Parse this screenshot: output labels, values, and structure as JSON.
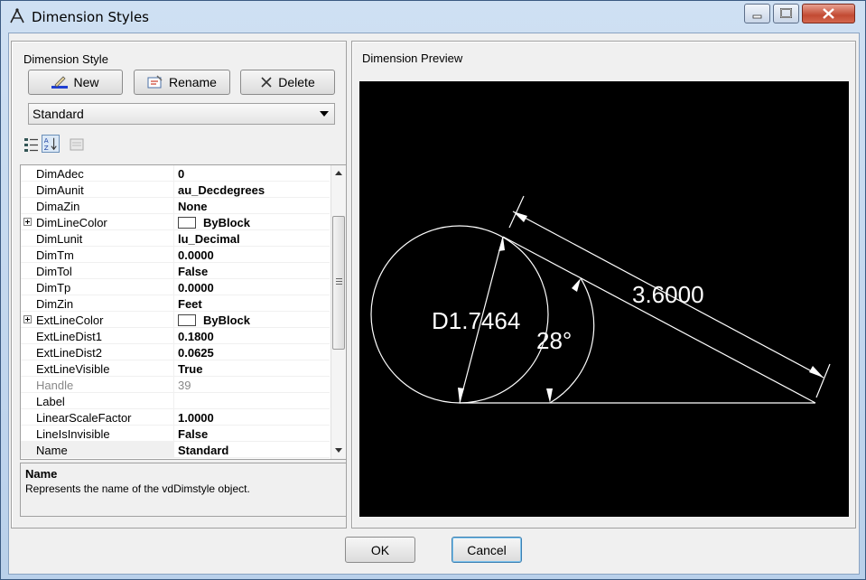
{
  "window": {
    "title": "Dimension Styles"
  },
  "left": {
    "group_label": "Dimension Style",
    "buttons": {
      "new": "New",
      "rename": "Rename",
      "delete": "Delete"
    },
    "style_select": "Standard",
    "properties": [
      {
        "name": "DimAdec",
        "value": "0"
      },
      {
        "name": "DimAunit",
        "value": "au_Decdegrees"
      },
      {
        "name": "DimaZin",
        "value": "None"
      },
      {
        "name": "DimLineColor",
        "value": "ByBlock",
        "expandable": true,
        "swatch": "#ffffff"
      },
      {
        "name": "DimLunit",
        "value": "lu_Decimal"
      },
      {
        "name": "DimTm",
        "value": "0.0000"
      },
      {
        "name": "DimTol",
        "value": "False"
      },
      {
        "name": "DimTp",
        "value": "0.0000"
      },
      {
        "name": "DimZin",
        "value": "Feet"
      },
      {
        "name": "ExtLineColor",
        "value": "ByBlock",
        "expandable": true,
        "swatch": "#ffffff"
      },
      {
        "name": "ExtLineDist1",
        "value": "0.1800"
      },
      {
        "name": "ExtLineDist2",
        "value": "0.0625"
      },
      {
        "name": "ExtLineVisible",
        "value": "True"
      },
      {
        "name": "Handle",
        "value": "39",
        "disabled": true
      },
      {
        "name": "Label",
        "value": ""
      },
      {
        "name": "LinearScaleFactor",
        "value": "1.0000"
      },
      {
        "name": "LineIsInvisible",
        "value": "False"
      },
      {
        "name": "Name",
        "value": "Standard",
        "selected": true
      }
    ],
    "help": {
      "name": "Name",
      "description": "Represents the name of the vdDimstyle object."
    }
  },
  "right": {
    "group_label": "Dimension Preview",
    "preview": {
      "diameter_text": "D1.7464",
      "angle_text": "28°",
      "linear_text": "3.6000"
    }
  },
  "footer": {
    "ok": "OK",
    "cancel": "Cancel"
  }
}
